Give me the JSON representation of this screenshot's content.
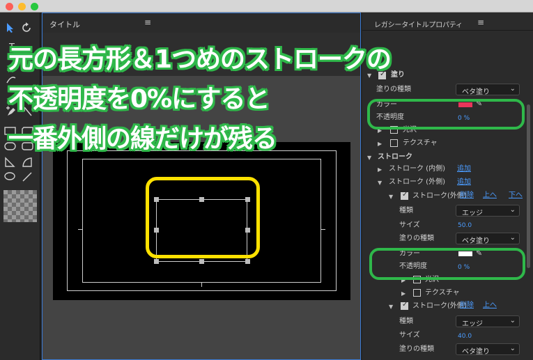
{
  "title_panel": {
    "title": "タイトル",
    "menu_icon": "hamburger-icon"
  },
  "properties": {
    "title": "レガシータイトルプロパティ",
    "fill_section": {
      "label": "塗り",
      "checked": true
    },
    "fill_type_label": "塗りの種類",
    "fill_type_value": "ベタ塗り",
    "color_label": "カラー",
    "fill_color": "#e8355a",
    "opacity_label": "不透明度",
    "opacity_value": "0 %",
    "gloss_label": "光沢",
    "texture_label": "テクスチャ",
    "stroke_section": "ストローク",
    "inner_stroke_label": "ストローク (内側)",
    "outer_stroke_label": "ストローク (外側)",
    "add_label": "追加",
    "delete_label": "削除",
    "up_label": "上へ",
    "down_label": "下へ",
    "stroke1": {
      "label": "ストローク(外側)",
      "type_label": "種類",
      "type_value": "エッジ",
      "size_label": "サイズ",
      "size_value": "50.0",
      "fill_type_label": "塗りの種類",
      "fill_type_value": "ベタ塗り",
      "color_label": "カラー",
      "color": "#ffffff",
      "opacity_label": "不透明度",
      "opacity_value": "0 %",
      "gloss_label": "光沢",
      "texture_label": "テクスチャ"
    },
    "stroke2": {
      "label": "ストローク(外側)",
      "type_label": "種類",
      "type_value": "エッジ",
      "size_label": "サイズ",
      "size_value": "40.0",
      "fill_type_label": "塗りの種類",
      "fill_type_value": "ベタ塗り"
    }
  },
  "overlay_caption": {
    "line1": "元の長方形＆1つめのストロークの",
    "line2": "不透明度を0%にすると",
    "line3": "一番外側の線だけが残る"
  },
  "colors": {
    "highlight_yellow": "#ffe100",
    "highlight_green": "#2fb84a",
    "link_blue": "#4b9cff"
  }
}
